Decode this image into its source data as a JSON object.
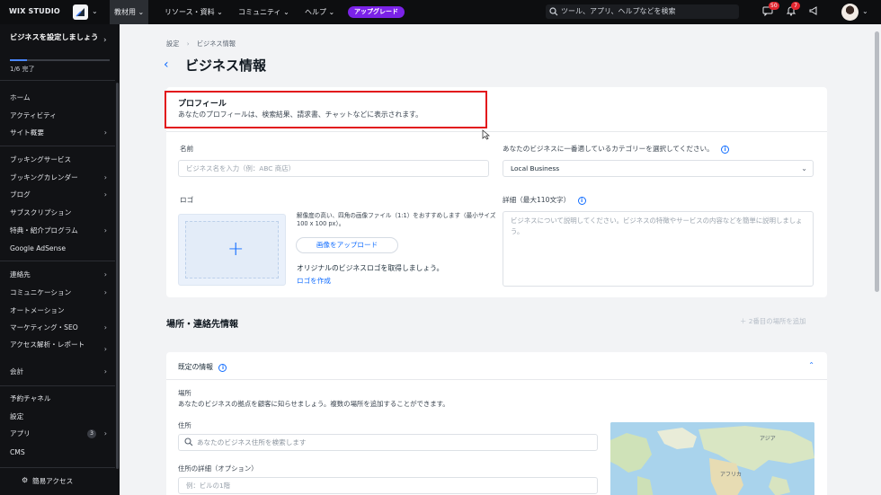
{
  "topbar": {
    "brand": "WIX STUDIO",
    "menu": [
      "教材用",
      "リソース・資料",
      "コミュニティ",
      "ヘルプ"
    ],
    "upgrade": "アップグレード",
    "search_placeholder": "ツール、アプリ、ヘルプなどを検索",
    "notifications": {
      "messages": "50",
      "alerts": "7"
    }
  },
  "sidebar": {
    "setup_title": "ビジネスを設定しましょう",
    "progress_text": "1/6 完了",
    "progress_fraction": 0.17,
    "items": [
      {
        "label": "ホーム",
        "chev": ""
      },
      {
        "label": "アクティビティ",
        "chev": ""
      },
      {
        "label": "サイト概要",
        "chev": "›"
      },
      {
        "label": "ブッキングサービス",
        "chev": ""
      },
      {
        "label": "ブッキングカレンダー",
        "chev": "›"
      },
      {
        "label": "ブログ",
        "chev": "›"
      },
      {
        "label": "サブスクリプション",
        "chev": ""
      },
      {
        "label": "特典・紹介プログラム",
        "chev": "›"
      },
      {
        "label": "Google AdSense",
        "chev": ""
      },
      {
        "label": "連絡先",
        "chev": "›"
      },
      {
        "label": "コミュニケーション",
        "chev": "›"
      },
      {
        "label": "オートメーション",
        "chev": ""
      },
      {
        "label": "マーケティング・SEO",
        "chev": "›"
      },
      {
        "label": "アクセス解析・レポート",
        "chev": "›"
      },
      {
        "label": "会計",
        "chev": "›"
      },
      {
        "label": "予約チャネル",
        "chev": ""
      },
      {
        "label": "設定",
        "chev": ""
      },
      {
        "label": "アプリ",
        "chev": "›",
        "count": "3"
      },
      {
        "label": "CMS",
        "chev": ""
      }
    ],
    "quick_access": "簡易アクセス"
  },
  "main": {
    "breadcrumb": [
      "設定",
      "ビジネス情報"
    ],
    "title": "ビジネス情報",
    "profile": {
      "title": "プロフィール",
      "description": "あなたのプロフィールは、検索結果、請求書、チャットなどに表示されます。",
      "name_label": "名前",
      "name_placeholder": "ビジネス名を入力（例：ABC 商店）",
      "category_label": "あなたのビジネスに一番適しているカテゴリーを選択してください。",
      "category_value": "Local Business",
      "logo_label": "ロゴ",
      "logo_hint": "解像度の高い、四角の画像ファイル（1:1）をおすすめします（最小サイズ100 x 100 px）。",
      "upload_label": "画像をアップロード",
      "logo_original": "オリジナルのビジネスロゴを取得しましょう。",
      "logo_create": "ロゴを作成",
      "detail_label": "詳細（最大110文字）",
      "detail_placeholder": "ビジネスについて説明してください。ビジネスの特徴やサービスの内容などを簡単に説明しましょう。"
    },
    "location_section": {
      "title": "場所・連絡先情報",
      "add_location": "＋ 2番目の場所を追加",
      "default_info": "既定の情報",
      "location_label": "場所",
      "location_desc": "あなたのビジネスの拠点を顧客に知らせましょう。複数の場所を追加することができます。",
      "address_label": "住所",
      "address_placeholder": "あなたのビジネス住所を検索します",
      "address_detail_label": "住所の詳細（オプション）",
      "address_detail_placeholder": "例：ビルの1階",
      "map_labels": [
        "アジア",
        "アフリカ"
      ]
    }
  }
}
